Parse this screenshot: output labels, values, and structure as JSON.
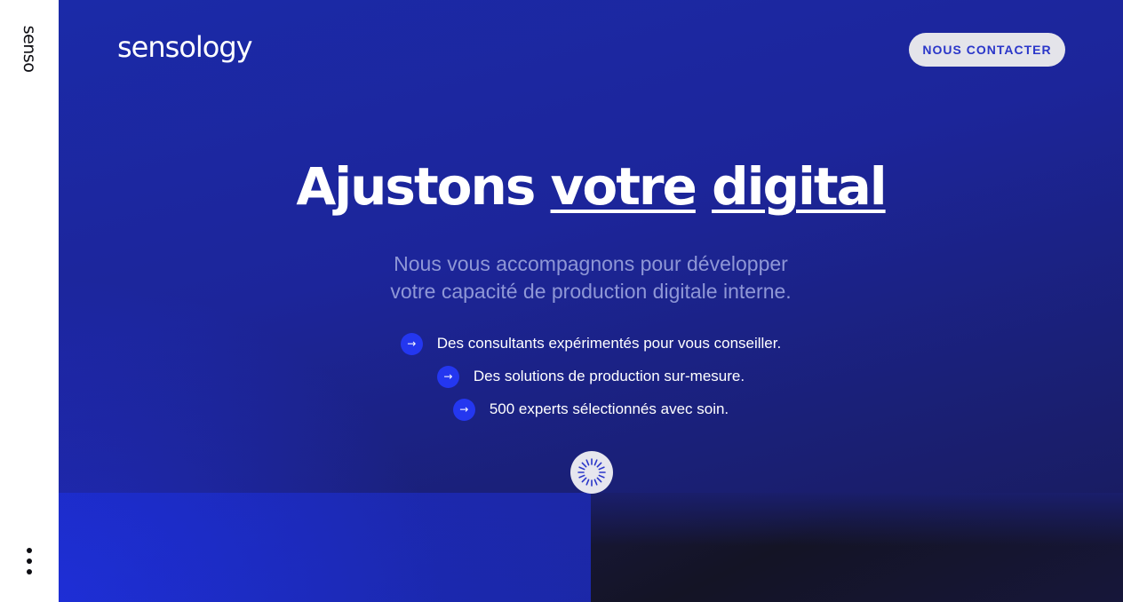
{
  "sidebar": {
    "logo": "senso",
    "menu_icon": "vertical-dots-icon"
  },
  "header": {
    "brand": "sensology",
    "contact_label": "NOUS CONTACTER"
  },
  "hero": {
    "headline_part1": "Ajustons",
    "headline_part2": "votre",
    "headline_part3": "digital",
    "subtitle_line1": "Nous vous accompagnons pour développer",
    "subtitle_line2": "votre capacité de production digitale interne.",
    "bullets": [
      "Des consultants expérimentés pour vous conseiller.",
      "Des solutions de production sur-mesure.",
      "500 experts sélectionnés avec soin."
    ],
    "bullet_icon": "arrow-right-icon",
    "scroll_icon": "spinner-icon"
  },
  "colors": {
    "background": "#1c259a",
    "accent": "#2437f0",
    "button_bg": "#e4e4ea",
    "button_text": "#2a36c9",
    "subtitle": "#8f97d6"
  }
}
